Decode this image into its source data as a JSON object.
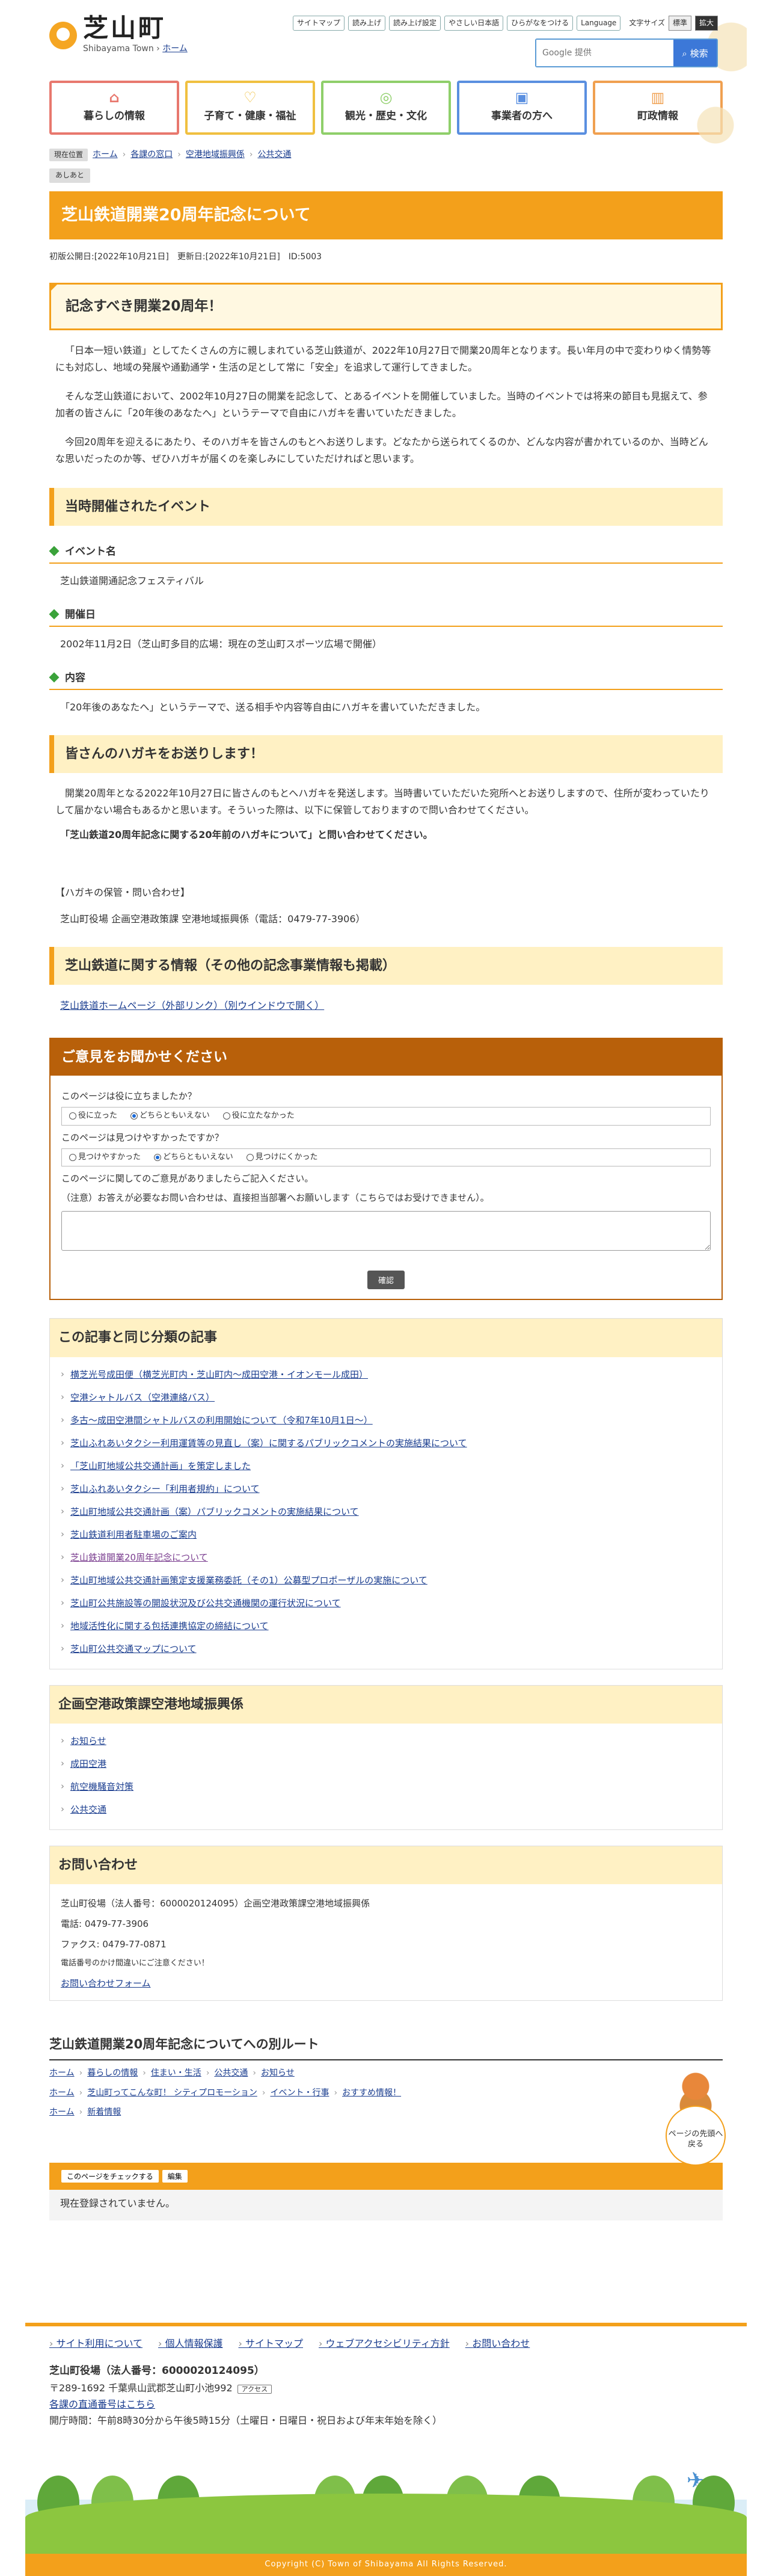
{
  "header": {
    "logo_title": "芝山町",
    "logo_sub": "Shibayama Town",
    "logo_sub_sep": " › ",
    "logo_home": "ホーム",
    "util": [
      "サイトマップ",
      "読み上げ",
      "読み上げ設定",
      "やさしい日本語",
      "ひらがなをつける",
      "Language"
    ],
    "font_size_label": "文字サイズ",
    "font_size_options": [
      "標準",
      "拡大"
    ],
    "search_placeholder": "Google 提供",
    "search_button": "検索"
  },
  "gnav": [
    {
      "label": "暮らしの情報",
      "icon": "home-icon",
      "color": "#e8786e",
      "glyph": "⌂"
    },
    {
      "label": "子育て・健康・福祉",
      "icon": "heart-icon",
      "color": "#f0c040",
      "glyph": "♡"
    },
    {
      "label": "観光・歴史・文化",
      "icon": "camera-icon",
      "color": "#8fcf6a",
      "glyph": "◎"
    },
    {
      "label": "事業者の方へ",
      "icon": "briefcase-icon",
      "color": "#5a8fe0",
      "glyph": "▣"
    },
    {
      "label": "町政情報",
      "icon": "building-icon",
      "color": "#f0a050",
      "glyph": "▥"
    }
  ],
  "breadcrumb": {
    "here_label": "現在位置",
    "items": [
      "ホーム",
      "各課の窓口",
      "空港地域振興係",
      "公共交通"
    ],
    "sep": "›"
  },
  "ashiato": "あしあと",
  "page": {
    "title": "芝山鉄道開業20周年記念について",
    "meta": "初版公開日:[2022年10月21日]　更新日:[2022年10月21日]　ID:5003",
    "h2": "記念すべき開業20周年！",
    "paras": [
      "「日本一短い鉄道」としてたくさんの方に親しまれている芝山鉄道が、2022年10月27日で開業20周年となります。長い年月の中で変わりゆく情勢等にも対応し、地域の発展や通勤通学・生活の足として常に「安全」を追求して運行してきました。",
      "そんな芝山鉄道において、2002年10月27日の開業を記念して、とあるイベントを開催していました。当時のイベントでは将来の節目も見据えて、参加者の皆さんに「20年後のあなたへ」というテーマで自由にハガキを書いていただきました。",
      "今回20周年を迎えるにあたり、そのハガキを皆さんのもとへお送りします。どなたから送られてくるのか、どんな内容が書かれているのか、当時どんな思いだったのか等、ぜひハガキが届くのを楽しみにしていただければと思います。"
    ],
    "h3_event": "当時開催されたイベント",
    "event_items": [
      {
        "label": "イベント名",
        "body": "芝山鉄道開通記念フェスティバル"
      },
      {
        "label": "開催日",
        "body": "2002年11月2日（芝山町多目的広場：現在の芝山町スポーツ広場で開催）"
      },
      {
        "label": "内容",
        "body": "「20年後のあなたへ」というテーマで、送る相手や内容等自由にハガキを書いていただきました。"
      }
    ],
    "h3_send": "皆さんのハガキをお送りします！",
    "send_para": "開業20周年となる2022年10月27日に皆さんのもとへハガキを発送します。当時書いていただいた宛所へとお送りしますので、住所が変わっていたりして届かない場合もあるかと思います。そういった際は、以下に保管しておりますので問い合わせてください。",
    "send_bold": "「芝山鉄道20周年記念に関する20年前のハガキについて」と問い合わせてください。",
    "contact_head": "【ハガキの保管・問い合わせ】",
    "contact_body": "芝山町役場 企画空港政策課 空港地域振興係（電話：0479-77-3906）",
    "h3_info": "芝山鉄道に関する情報（その他の記念事業情報も掲載）",
    "info_link": "芝山鉄道ホームページ（外部リンク）（別ウインドウで開く）"
  },
  "feedback": {
    "title": "ご意見をお聞かせください",
    "q1": "このページは役に立ちましたか？",
    "q1_options": [
      "役に立った",
      "どちらともいえない",
      "役に立たなかった"
    ],
    "q2": "このページは見つけやすかったですか？",
    "q2_options": [
      "見つけやすかった",
      "どちらともいえない",
      "見つけにくかった"
    ],
    "q3": "このページに関してのご意見がありましたらご記入ください。",
    "note": "（注意）お答えが必要なお問い合わせは、直接担当部署へお願いします（こちらではお受けできません）。",
    "submit": "確認"
  },
  "related": {
    "title": "この記事と同じ分類の記事",
    "items": [
      "横芝光号成田便（横芝光町内・芝山町内～成田空港・イオンモール成田）",
      "空港シャトルバス（空港連絡バス）",
      "多古～成田空港間シャトルバスの利用開始について（令和7年10月1日～）",
      "芝山ふれあいタクシー利用運賃等の見直し（案）に関するパブリックコメントの実施結果について",
      "「芝山町地域公共交通計画」を策定しました",
      "芝山ふれあいタクシー「利用者規約」について",
      "芝山町地域公共交通計画（案）パブリックコメントの実施結果について",
      "芝山鉄道利用者駐車場のご案内",
      "芝山鉄道開業20周年記念について",
      "芝山町地域公共交通計画策定支援業務委託（その1）公募型プロポーザルの実施について",
      "芝山町公共施設等の開設状況及び公共交通機関の運行状況について",
      "地域活性化に関する包括連携協定の締結について",
      "芝山町公共交通マップについて"
    ]
  },
  "section_box": {
    "title": "企画空港政策課空港地域振興係",
    "items": [
      "お知らせ",
      "成田空港",
      "航空機騒音対策",
      "公共交通"
    ]
  },
  "contact": {
    "title": "お問い合わせ",
    "org": "芝山町役場（法人番号：6000020124095）企画空港政策課空港地域振興係",
    "tel": "電話: 0479-77-3906",
    "fax": "ファクス: 0479-77-0871",
    "note": "電話番号のかけ間違いにご注意ください！",
    "form_link": "お問い合わせフォーム"
  },
  "routes": {
    "title": "芝山鉄道開業20周年記念についてへの別ルート",
    "rows": [
      [
        "ホーム",
        "暮らしの情報",
        "住まい・生活",
        "公共交通",
        "お知らせ"
      ],
      [
        "ホーム",
        "芝山町ってこんな町！ シティプロモーション",
        "イベント・行事",
        "おすすめ情報！"
      ],
      [
        "ホーム",
        "新着情報"
      ]
    ]
  },
  "check": {
    "btn1": "このページをチェックする",
    "btn2": "編集",
    "body": "現在登録されていません。"
  },
  "pagetop": "ページの先頭へ戻る",
  "footer": {
    "links": [
      "サイト利用について",
      "個人情報保護",
      "サイトマップ",
      "ウェブアクセシビリティ方針",
      "お問い合わせ"
    ],
    "org": "芝山町役場（法人番号：6000020124095）",
    "address": "〒289-1692 千葉県山武郡芝山町小池992",
    "access": "アクセス",
    "phone_link": "各課の直通番号はこちら",
    "hours": "開庁時間：午前8時30分から午後5時15分（土曜日・日曜日・祝日および年末年始を除く）",
    "copyright": "Copyright (C) Town of Shibayama All Rights Reserved."
  }
}
